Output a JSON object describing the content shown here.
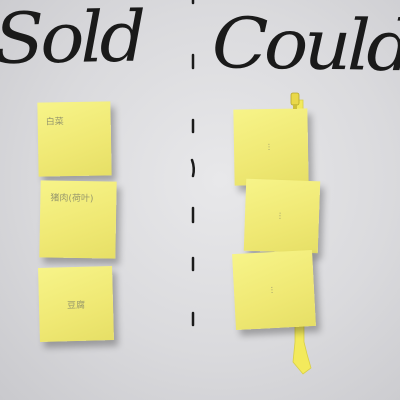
{
  "scene": {
    "headings": {
      "left": "Sold",
      "right": "Could"
    },
    "left_notes": [
      {
        "text": "白菜"
      },
      {
        "text": "猪肉(荷叶)"
      },
      {
        "text": "豆腐"
      }
    ],
    "right_notes": [
      {
        "text": "..."
      },
      {
        "text": "..."
      },
      {
        "text": "..."
      }
    ],
    "colors": {
      "board": "#dcdcde",
      "sticky_note": "#f2ec78",
      "ink": "#1a1a1a",
      "tape": "#f3ea5c"
    }
  }
}
